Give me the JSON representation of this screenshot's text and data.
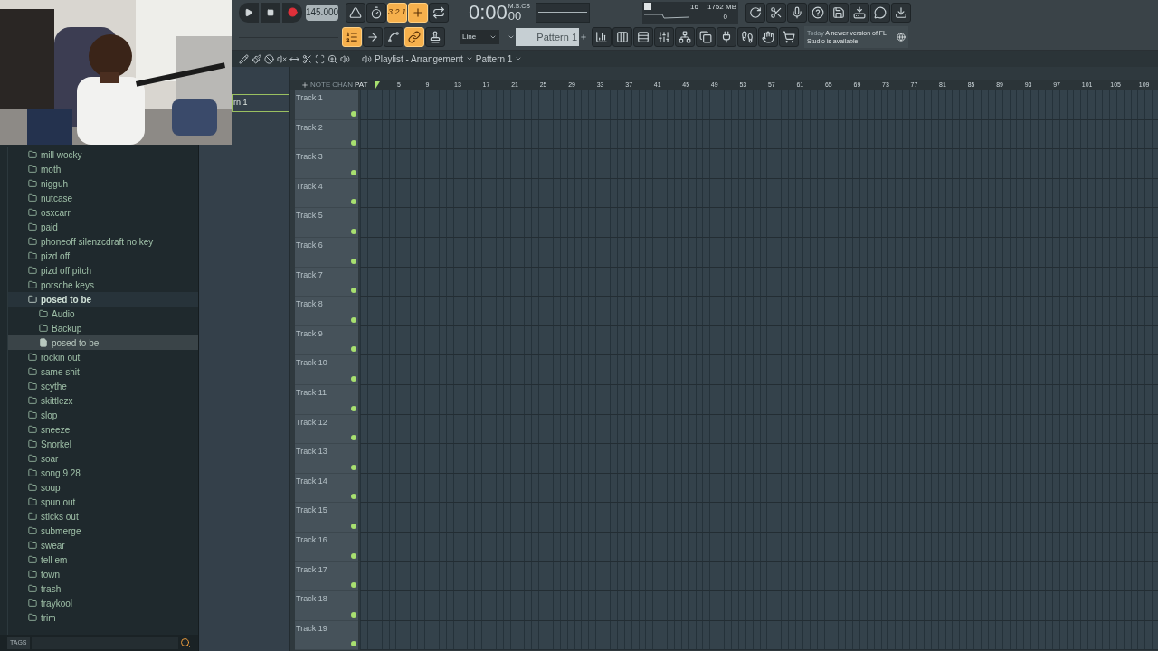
{
  "transport": {
    "tempo": "145.000",
    "time": "0:00",
    "time_sub": "00",
    "time_format": "M:S:CS"
  },
  "record_toggles": [
    {
      "on": false
    },
    {
      "on": false
    },
    {
      "on": true,
      "label": "3.2.1"
    },
    {
      "on": true
    },
    {
      "on": false
    }
  ],
  "edit_toggles": [
    {
      "on": true
    },
    {
      "on": false
    },
    {
      "on": false
    },
    {
      "on": true
    },
    {
      "on": false
    }
  ],
  "snap": "Line",
  "pattern": "Pattern 1",
  "monitor": {
    "cpu": "16",
    "memory": "1752 MB",
    "polyphony": "0"
  },
  "news": {
    "date": "Today",
    "text": "A newer version of FL Studio is available!"
  },
  "playlist": {
    "title": "Playlist - Arrangement",
    "pattern": "Pattern 1"
  },
  "picker": {
    "items": [
      {
        "label": "rn 1",
        "selected": true
      }
    ]
  },
  "ruler": {
    "labels": [
      "NOTE",
      "CHAN",
      "PAT"
    ],
    "bars": [
      "5",
      "9",
      "13",
      "17",
      "21",
      "25",
      "29",
      "33",
      "37",
      "41",
      "45",
      "49",
      "53",
      "57",
      "61",
      "65",
      "69",
      "73",
      "77",
      "81",
      "85",
      "89",
      "93",
      "97",
      "101",
      "105",
      "109"
    ]
  },
  "tracks": [
    {
      "name": "Track 1",
      "on": true
    },
    {
      "name": "Track 2",
      "on": true
    },
    {
      "name": "Track 3",
      "on": true
    },
    {
      "name": "Track 4",
      "on": true
    },
    {
      "name": "Track 5",
      "on": true
    },
    {
      "name": "Track 6",
      "on": true
    },
    {
      "name": "Track 7",
      "on": true
    },
    {
      "name": "Track 8",
      "on": true
    },
    {
      "name": "Track 9",
      "on": true
    },
    {
      "name": "Track 10",
      "on": true
    },
    {
      "name": "Track 11",
      "on": true
    },
    {
      "name": "Track 12",
      "on": true
    },
    {
      "name": "Track 13",
      "on": true
    },
    {
      "name": "Track 14",
      "on": true
    },
    {
      "name": "Track 15",
      "on": true
    },
    {
      "name": "Track 16",
      "on": true
    },
    {
      "name": "Track 17",
      "on": true
    },
    {
      "name": "Track 18",
      "on": true
    },
    {
      "name": "Track 19",
      "on": true
    }
  ],
  "browser": {
    "items": [
      {
        "label": "mill wocky",
        "kind": "folder",
        "expanded": false,
        "selected": false
      },
      {
        "label": "moth",
        "kind": "folder",
        "expanded": false,
        "selected": false
      },
      {
        "label": "nigguh",
        "kind": "folder",
        "expanded": false,
        "selected": false
      },
      {
        "label": "nutcase",
        "kind": "folder",
        "expanded": false,
        "selected": false
      },
      {
        "label": "osxcarr",
        "kind": "folder",
        "expanded": false,
        "selected": false
      },
      {
        "label": "paid",
        "kind": "folder",
        "expanded": false,
        "selected": false
      },
      {
        "label": "phoneoff silenzcdraft no key",
        "kind": "folder",
        "expanded": false,
        "selected": false
      },
      {
        "label": "pizd off",
        "kind": "folder",
        "expanded": false,
        "selected": false
      },
      {
        "label": "pizd off pitch",
        "kind": "folder",
        "expanded": false,
        "selected": false
      },
      {
        "label": "porsche keys",
        "kind": "folder",
        "expanded": false,
        "selected": false
      },
      {
        "label": "posed to be",
        "kind": "folder",
        "expanded": true,
        "selected": false,
        "children": [
          {
            "label": "Audio",
            "kind": "folder",
            "expanded": false,
            "selected": false
          },
          {
            "label": "Backup",
            "kind": "folder",
            "expanded": false,
            "selected": false
          },
          {
            "label": "posed to be",
            "kind": "file",
            "selected": true
          }
        ]
      },
      {
        "label": "rockin out",
        "kind": "folder",
        "expanded": false,
        "selected": false
      },
      {
        "label": "same shit",
        "kind": "folder",
        "expanded": false,
        "selected": false
      },
      {
        "label": "scythe",
        "kind": "folder",
        "expanded": false,
        "selected": false
      },
      {
        "label": "skittlezx",
        "kind": "folder",
        "expanded": false,
        "selected": false
      },
      {
        "label": "slop",
        "kind": "folder",
        "expanded": false,
        "selected": false
      },
      {
        "label": "sneeze",
        "kind": "folder",
        "expanded": false,
        "selected": false
      },
      {
        "label": "Snorkel",
        "kind": "folder",
        "expanded": false,
        "selected": false
      },
      {
        "label": "soar",
        "kind": "folder",
        "expanded": false,
        "selected": false
      },
      {
        "label": "song 9 28",
        "kind": "folder",
        "expanded": false,
        "selected": false
      },
      {
        "label": "soup",
        "kind": "folder",
        "expanded": false,
        "selected": false
      },
      {
        "label": "spun out",
        "kind": "folder",
        "expanded": false,
        "selected": false
      },
      {
        "label": "sticks out",
        "kind": "folder",
        "expanded": false,
        "selected": false
      },
      {
        "label": "submerge",
        "kind": "folder",
        "expanded": false,
        "selected": false
      },
      {
        "label": "swear",
        "kind": "folder",
        "expanded": false,
        "selected": false
      },
      {
        "label": "tell em",
        "kind": "folder",
        "expanded": false,
        "selected": false
      },
      {
        "label": "town",
        "kind": "folder",
        "expanded": false,
        "selected": false
      },
      {
        "label": "trash",
        "kind": "folder",
        "expanded": false,
        "selected": false
      },
      {
        "label": "traykool",
        "kind": "folder",
        "expanded": false,
        "selected": false
      },
      {
        "label": "trim",
        "kind": "folder",
        "expanded": false,
        "selected": false
      }
    ],
    "tags_label": "TAGS"
  }
}
